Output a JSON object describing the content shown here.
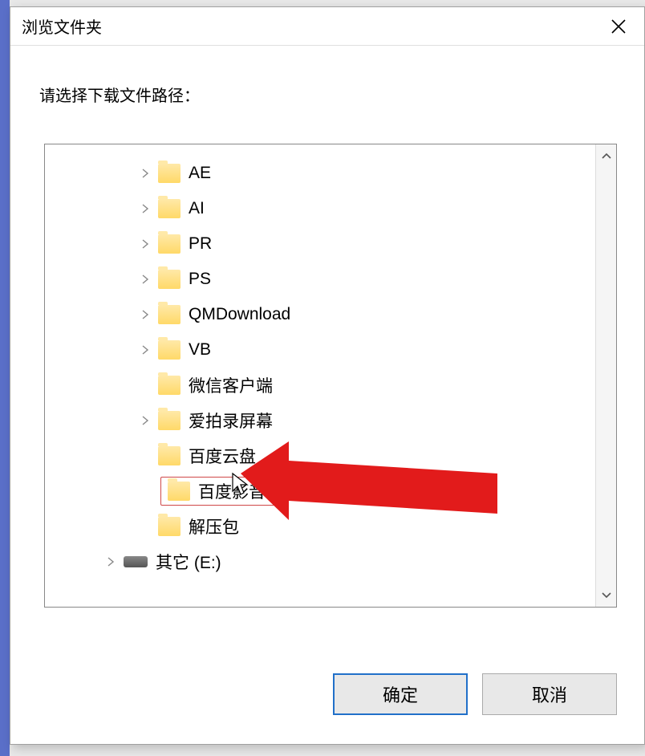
{
  "dialog": {
    "title": "浏览文件夹",
    "instruction": "请选择下载文件路径：",
    "close_label": "关闭"
  },
  "tree": {
    "items": [
      {
        "label": "AE",
        "type": "folder",
        "expandable": true,
        "indent": 1
      },
      {
        "label": "AI",
        "type": "folder",
        "expandable": true,
        "indent": 1
      },
      {
        "label": "PR",
        "type": "folder",
        "expandable": true,
        "indent": 1
      },
      {
        "label": "PS",
        "type": "folder",
        "expandable": true,
        "indent": 1
      },
      {
        "label": "QMDownload",
        "type": "folder",
        "expandable": true,
        "indent": 1
      },
      {
        "label": "VB",
        "type": "folder",
        "expandable": true,
        "indent": 1
      },
      {
        "label": "微信客户端",
        "type": "folder",
        "expandable": false,
        "indent": 1
      },
      {
        "label": "爱拍录屏幕",
        "type": "folder",
        "expandable": true,
        "indent": 1
      },
      {
        "label": "百度云盘",
        "type": "folder",
        "expandable": false,
        "indent": 1
      },
      {
        "label": "百度影音",
        "type": "folder",
        "expandable": false,
        "indent": 1,
        "selected": true
      },
      {
        "label": "解压包",
        "type": "folder",
        "expandable": false,
        "indent": 1
      },
      {
        "label": "其它 (E:)",
        "type": "drive",
        "expandable": true,
        "indent": 0
      }
    ]
  },
  "buttons": {
    "ok": "确定",
    "cancel": "取消"
  },
  "annotation": {
    "arrow_target": "百度影音"
  }
}
